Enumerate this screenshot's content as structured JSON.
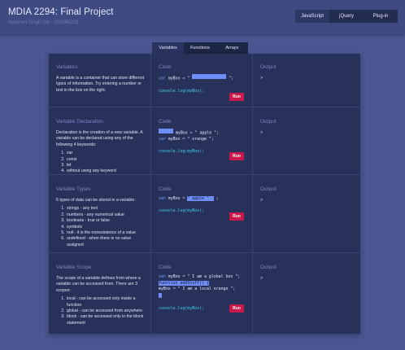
{
  "header": {
    "title": "MDIA 2294: Final Project",
    "subtitle": "Harpreet Singh Gill - A01068219"
  },
  "topnav": [
    {
      "label": "JavaScript",
      "active": true
    },
    {
      "label": "jQuery",
      "active": false
    },
    {
      "label": "Plug-in",
      "active": false
    }
  ],
  "subtabs": [
    {
      "label": "Variables",
      "active": true
    },
    {
      "label": "Functions",
      "active": false
    },
    {
      "label": "Arrays",
      "active": false
    }
  ],
  "labels": {
    "code": "Code",
    "output": "Output",
    "run": "Run",
    "prompt": ">"
  },
  "sections": [
    {
      "title": "Variables",
      "text": "A variable is a container that can store different types of information. Try entering a number or text in the box on the right.",
      "list": []
    },
    {
      "title": "Variable Declaration",
      "text": "Declaration is the creation of a new variable. A variable can be declared using any of the following 4 keywords:",
      "list": [
        "var",
        "const",
        "let",
        "wihtout using any keyword"
      ]
    },
    {
      "title": "Variable Types",
      "text": "6 types of data can be stored in a variable:",
      "list": [
        "strings - any text",
        "numbers - any numerical value",
        "booleans - true or false",
        "symbols",
        "null - it is the nonexistence of a value",
        "undefined - when there is no value assigned"
      ]
    },
    {
      "title": "Variable Scope",
      "text": "The scope of a variable defines from where a variable can be accessed from. There are 3 scopes:",
      "list": [
        "local - can be accessed only inside a function",
        "global - can be accessed from anywhere",
        "block - can be accessed only in the block statement"
      ]
    }
  ],
  "code": {
    "var_kw": "var",
    "my_box": "myBox",
    "eq": "=",
    "quote": "\"",
    "semi": ";",
    "console_log": "console.log(myBox);",
    "apple": "apple",
    "orange": "orange",
    "apple_val": " apple ",
    "global_box": "I am a global box",
    "function_line": "function addStuff() {",
    "local_orange": "I am a local orange"
  }
}
